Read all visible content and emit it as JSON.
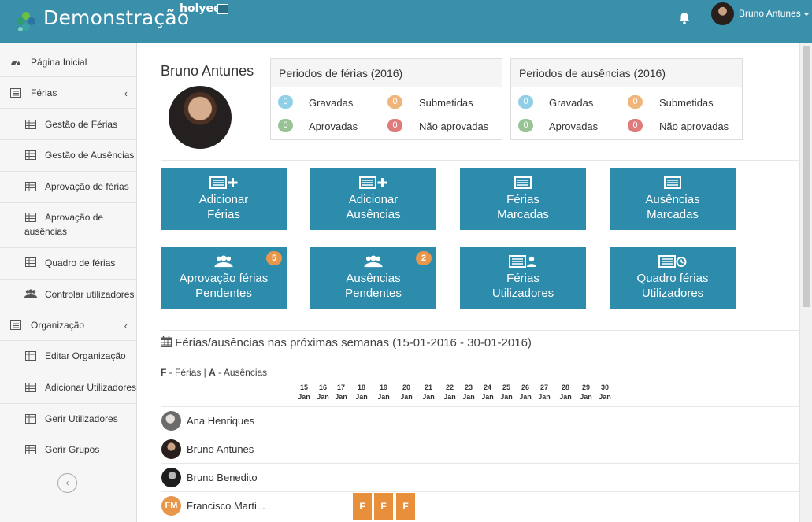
{
  "header": {
    "brand": "Demonstração",
    "tenant": "holyee",
    "user_name": "Bruno Antunes"
  },
  "sidebar": {
    "items": [
      {
        "label": "Página Inicial",
        "icon": "dashboard-icon"
      },
      {
        "label": "Férias",
        "icon": "list-icon"
      },
      {
        "label": "Gestão de Férias",
        "icon": "table-icon"
      },
      {
        "label": "Gestão de Ausências",
        "icon": "table-icon"
      },
      {
        "label": "Aprovação de férias",
        "icon": "table-icon"
      },
      {
        "label": "Aprovação de ausências",
        "icon": "table-icon"
      },
      {
        "label": "Quadro de férias",
        "icon": "table-icon"
      },
      {
        "label": "Controlar utilizadores",
        "icon": "users-icon"
      },
      {
        "label": "Organização",
        "icon": "list-icon"
      },
      {
        "label": "Editar Organização",
        "icon": "table-icon"
      },
      {
        "label": "Adicionar Utilizadores",
        "icon": "table-icon"
      },
      {
        "label": "Gerir Utilizadores",
        "icon": "table-icon"
      },
      {
        "label": "Gerir Grupos",
        "icon": "table-icon"
      }
    ],
    "collapse_glyph": "‹"
  },
  "profile": {
    "name": "Bruno Antunes"
  },
  "panels": {
    "ferias": {
      "title": "Periodos de férias (2016)",
      "gravadas_label": "Gravadas",
      "gravadas_value": "0",
      "submetidas_label": "Submetidas",
      "submetidas_value": "0",
      "aprovadas_label": "Aprovadas",
      "aprovadas_value": "0",
      "nao_aprovadas_label": "Não aprovadas",
      "nao_aprovadas_value": "0"
    },
    "ausencias": {
      "title": "Periodos de ausências (2016)",
      "gravadas_label": "Gravadas",
      "gravadas_value": "0",
      "submetidas_label": "Submetidas",
      "submetidas_value": "0",
      "aprovadas_label": "Aprovadas",
      "aprovadas_value": "0",
      "nao_aprovadas_label": "Não aprovadas",
      "nao_aprovadas_value": "0"
    }
  },
  "tiles": [
    {
      "line1": "Adicionar",
      "line2": "Férias"
    },
    {
      "line1": "Adicionar",
      "line2": "Ausências"
    },
    {
      "line1": "Férias",
      "line2": "Marcadas"
    },
    {
      "line1": "Ausências",
      "line2": "Marcadas"
    },
    {
      "line1": "Aprovação férias",
      "line2": "Pendentes",
      "badge": "5"
    },
    {
      "line1": "Ausências",
      "line2": "Pendentes",
      "badge": "2"
    },
    {
      "line1": "Férias",
      "line2": "Utilizadores"
    },
    {
      "line1": "Quadro férias",
      "line2": "Utilizadores"
    }
  ],
  "calendar": {
    "title": "Férias/ausências nas próximas semanas (15-01-2016 - 30-01-2016)",
    "legend_f": "F",
    "legend_f_text": " - Férias | ",
    "legend_a": "A",
    "legend_a_text": " - Ausências",
    "days": [
      "15",
      "16",
      "17",
      "18",
      "19",
      "20",
      "21",
      "22",
      "23",
      "24",
      "25",
      "26",
      "27",
      "28",
      "29",
      "30"
    ],
    "month": "Jan",
    "people": [
      {
        "name": "Ana Henriques"
      },
      {
        "name": "Bruno Antunes"
      },
      {
        "name": "Bruno Benedito"
      },
      {
        "name": "Francisco Marti...",
        "initials": "FM"
      }
    ],
    "marks": [
      "F",
      "F",
      "F"
    ]
  },
  "colors": {
    "header": "#3a8fab",
    "tile": "#2d8bac",
    "badge_info": "#8fd0e6",
    "badge_warning": "#f0b57a",
    "badge_success": "#98c394",
    "badge_danger": "#df7b7b",
    "mark_ferias": "#e88f3c"
  }
}
